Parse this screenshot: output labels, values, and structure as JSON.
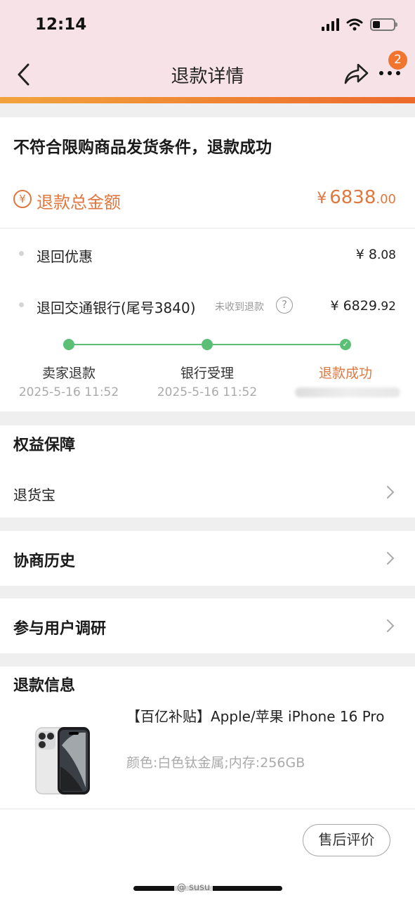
{
  "status_bar": {
    "time": "12:14"
  },
  "nav": {
    "title": "退款详情",
    "badge_count": "2"
  },
  "refund": {
    "headline": "不符合限购商品发货条件，退款成功",
    "total_icon": "¥",
    "total_label": "退款总金额",
    "total_currency": "¥",
    "total_integer": "6838",
    "total_cents": ".00",
    "rows": [
      {
        "label": "退回优惠",
        "amount_integer": "¥ 8",
        "amount_cents": ".08"
      },
      {
        "label": "退回交通银行(尾号3840)",
        "note": "未收到退款",
        "help": "?",
        "amount_integer": "¥ 6829",
        "amount_cents": ".92"
      }
    ],
    "steps": [
      {
        "label": "卖家退款",
        "time": "2025-5-16 11:52",
        "state": "done"
      },
      {
        "label": "银行受理",
        "time": "2025-5-16 11:52",
        "state": "done"
      },
      {
        "label": "退款成功",
        "time": "",
        "state": "active"
      }
    ]
  },
  "rights": {
    "title": "权益保障",
    "item": "退货宝"
  },
  "history": {
    "title": "协商历史"
  },
  "survey": {
    "title": "参与用户调研"
  },
  "refund_info": {
    "title": "退款信息",
    "product_title": "【百亿补贴】Apple/苹果 iPhone 16 Pro",
    "product_spec": "颜色:白色钛金属;内存:256GB",
    "review_button": "售后评价"
  },
  "watermark": "@ susu",
  "colors": {
    "accent": "#e0773e",
    "progress": "#5bbf75",
    "header_bg": "#f6e2e7"
  }
}
